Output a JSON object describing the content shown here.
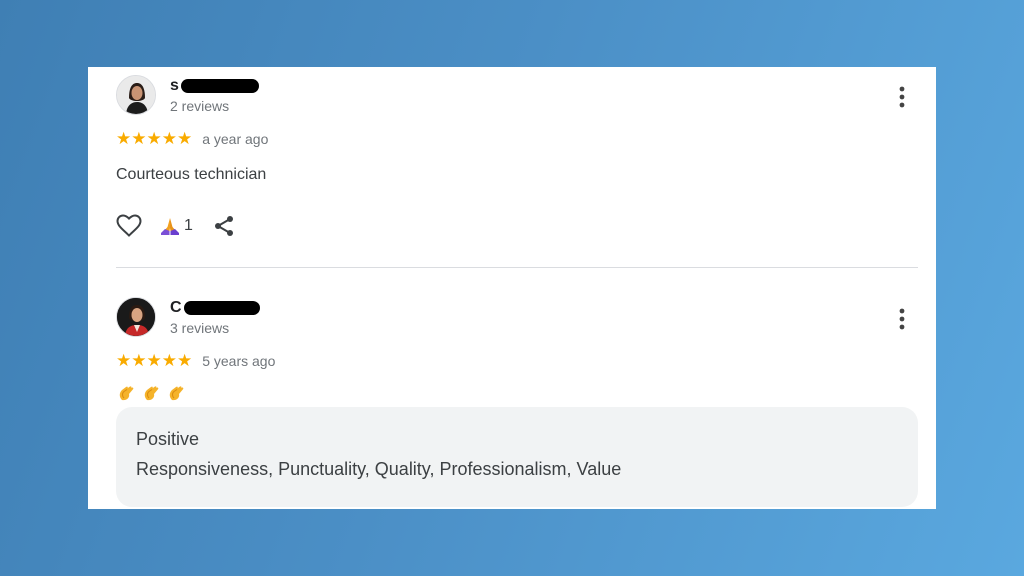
{
  "reviews": [
    {
      "name_visible": "s",
      "review_count": "2 reviews",
      "stars": "★★★★★",
      "rating": 5,
      "age": "a year ago",
      "text": "Courteous technician",
      "helpful_count": "1"
    },
    {
      "name_visible": "C",
      "review_count": "3 reviews",
      "stars": "★★★★★",
      "rating": 5,
      "age": "5 years ago",
      "emojis": [
        "👏",
        "👏",
        "👏"
      ],
      "attributes_title": "Positive",
      "attributes_values": "Responsiveness, Punctuality, Quality, Professionalism, Value"
    }
  ],
  "colors": {
    "star": "#f9ab00",
    "redaction": "#000000",
    "background_gradient_start": "#3f7fb4",
    "background_gradient_end": "#5aa8df"
  },
  "icons": {
    "menu": "more-vert-icon",
    "like": "heart-outline-icon",
    "helpful": "folded-hands-icon",
    "share": "share-icon"
  }
}
